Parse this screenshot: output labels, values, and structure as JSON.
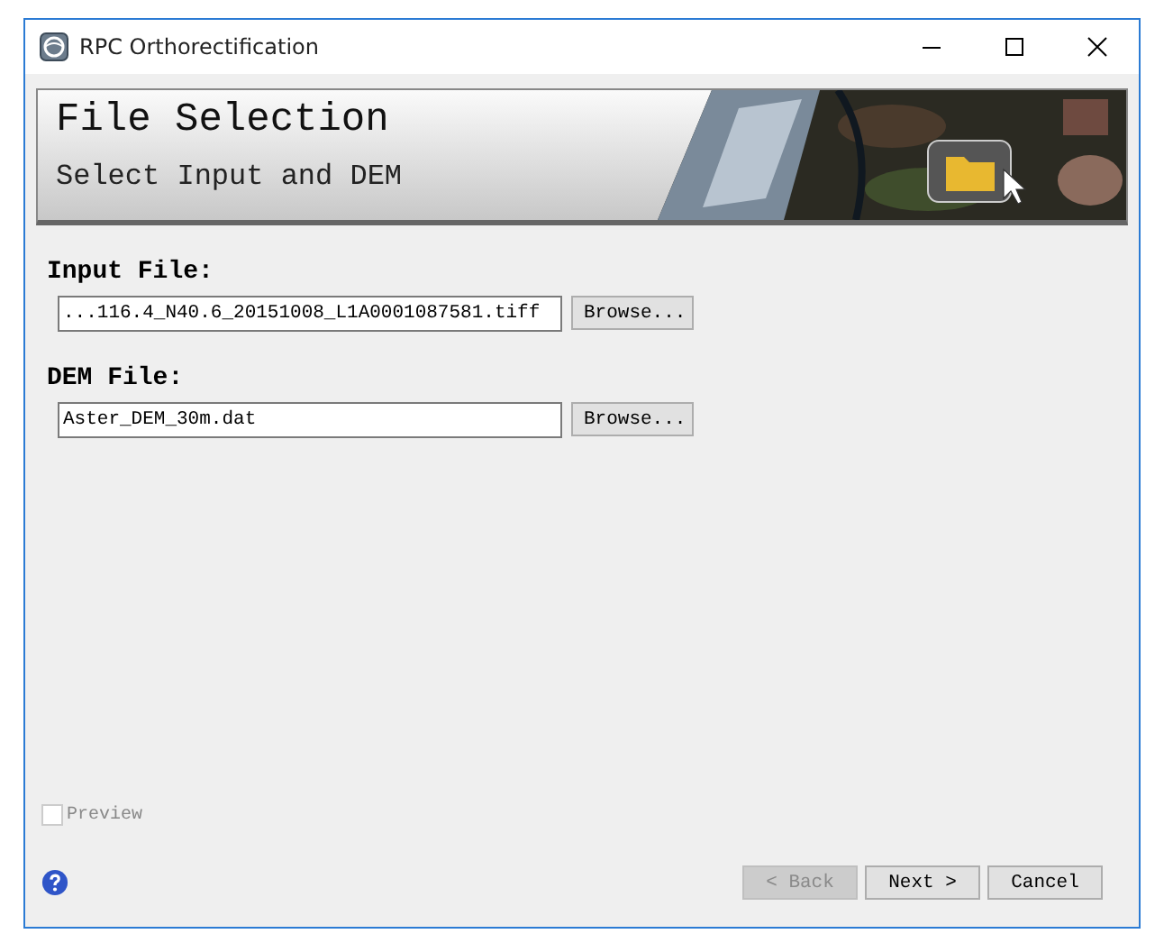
{
  "window": {
    "title": "RPC Orthorectification"
  },
  "banner": {
    "title": "File Selection",
    "subtitle": "Select Input and DEM"
  },
  "fields": [
    {
      "label": "Input File:",
      "value": "...116.4_N40.6_20151008_L1A0001087581.tiff",
      "button": "Browse..."
    },
    {
      "label": "DEM File:",
      "value": "Aster_DEM_30m.dat",
      "button": "Browse..."
    }
  ],
  "preview": {
    "label": "Preview",
    "checked": false,
    "disabled": true
  },
  "buttons": [
    {
      "label": "< Back",
      "disabled": true
    },
    {
      "label": "Next >",
      "disabled": false
    },
    {
      "label": "Cancel",
      "disabled": false
    }
  ]
}
